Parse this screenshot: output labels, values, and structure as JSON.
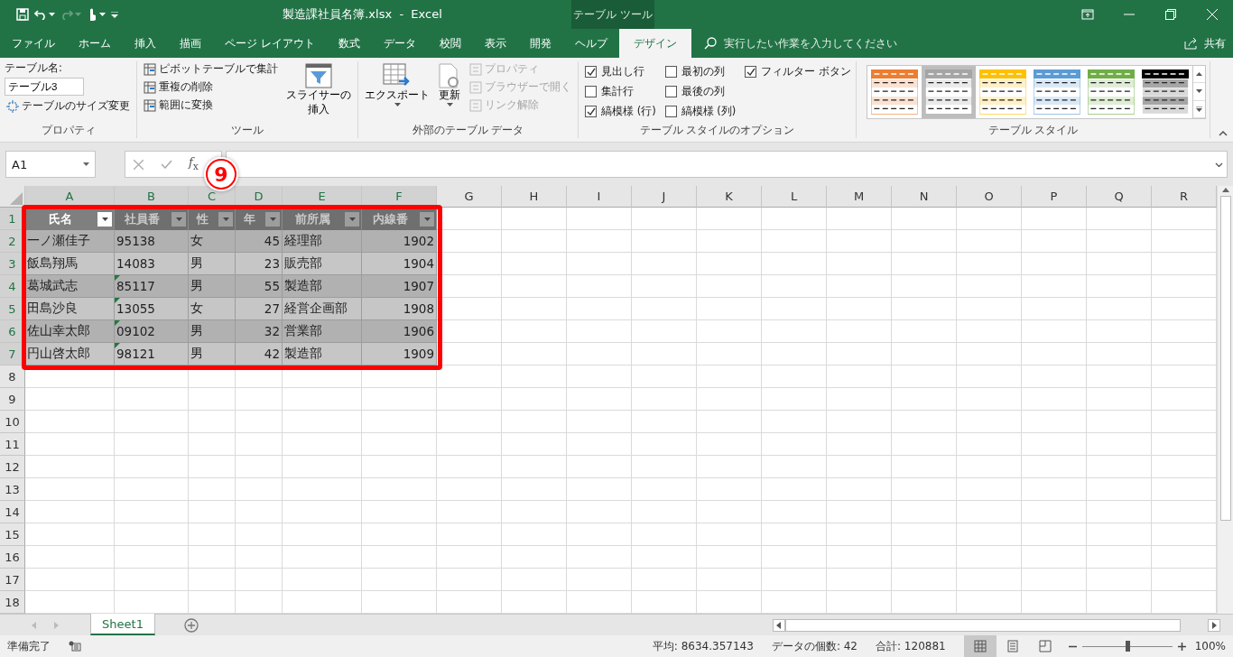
{
  "title_bar": {
    "title": "製造課社員名簿.xlsx  -  Excel",
    "context_tab": "テーブル ツール"
  },
  "ribbon_tabs": [
    {
      "label": "ファイル",
      "selected": false
    },
    {
      "label": "ホーム",
      "selected": false
    },
    {
      "label": "挿入",
      "selected": false
    },
    {
      "label": "描画",
      "selected": false
    },
    {
      "label": "ページ レイアウト",
      "selected": false
    },
    {
      "label": "数式",
      "selected": false
    },
    {
      "label": "データ",
      "selected": false
    },
    {
      "label": "校閲",
      "selected": false
    },
    {
      "label": "表示",
      "selected": false
    },
    {
      "label": "開発",
      "selected": false
    },
    {
      "label": "ヘルプ",
      "selected": false
    },
    {
      "label": "デザイン",
      "selected": true
    }
  ],
  "tell_me": {
    "placeholder": "実行したい作業を入力してください"
  },
  "share": "共有",
  "ribbon": {
    "properties": {
      "label": "テーブル名:",
      "table_name": "テーブル3",
      "resize": "テーブルのサイズ変更",
      "group": "プロパティ"
    },
    "tools": {
      "items": [
        "ピボットテーブルで集計",
        "重複の削除",
        "範囲に変換"
      ],
      "slicer": [
        "スライサーの",
        "挿入"
      ],
      "group": "ツール"
    },
    "external": {
      "export": "エクスポート",
      "refresh": "更新",
      "links": [
        {
          "label": "プロパティ",
          "disabled": true
        },
        {
          "label": "ブラウザーで開く",
          "disabled": true
        },
        {
          "label": "リンク解除",
          "disabled": true
        }
      ],
      "group": "外部のテーブル データ"
    },
    "style_options": {
      "options": [
        {
          "label": "見出し行",
          "checked": true
        },
        {
          "label": "集計行",
          "checked": false
        },
        {
          "label": "縞模様 (行)",
          "checked": true
        },
        {
          "label": "最初の列",
          "checked": false
        },
        {
          "label": "最後の列",
          "checked": false
        },
        {
          "label": "縞模様 (列)",
          "checked": false
        },
        {
          "label": "フィルター ボタン",
          "checked": true
        }
      ],
      "group": "テーブル スタイルのオプション"
    },
    "styles": {
      "items": [
        {
          "color": "#ed7d31",
          "selected": false
        },
        {
          "color": "#a5a5a5",
          "selected": true
        },
        {
          "color": "#ffc000",
          "selected": false
        },
        {
          "color": "#5b9bd5",
          "selected": false
        },
        {
          "color": "#70ad47",
          "selected": false
        },
        {
          "color": "#000000",
          "selected": false
        }
      ],
      "group": "テーブル スタイル"
    }
  },
  "formula_bar": {
    "name_box": "A1",
    "fx": "*f*$_{x}$"
  },
  "columns": [
    {
      "label": "A",
      "selected": true
    },
    {
      "label": "B",
      "selected": true
    },
    {
      "label": "C",
      "selected": true
    },
    {
      "label": "D",
      "selected": true
    },
    {
      "label": "E",
      "selected": true
    },
    {
      "label": "F",
      "selected": true
    },
    {
      "label": "G",
      "selected": false
    },
    {
      "label": "H",
      "selected": false
    },
    {
      "label": "I",
      "selected": false
    },
    {
      "label": "J",
      "selected": false
    },
    {
      "label": "K",
      "selected": false
    },
    {
      "label": "L",
      "selected": false
    },
    {
      "label": "M",
      "selected": false
    },
    {
      "label": "N",
      "selected": false
    },
    {
      "label": "O",
      "selected": false
    },
    {
      "label": "P",
      "selected": false
    },
    {
      "label": "Q",
      "selected": false
    },
    {
      "label": "R",
      "selected": false
    }
  ],
  "rows": [
    {
      "label": "1",
      "selected": true
    },
    {
      "label": "2",
      "selected": true
    },
    {
      "label": "3",
      "selected": true
    },
    {
      "label": "4",
      "selected": true
    },
    {
      "label": "5",
      "selected": true
    },
    {
      "label": "6",
      "selected": true
    },
    {
      "label": "7",
      "selected": true
    },
    {
      "label": "8",
      "selected": false
    },
    {
      "label": "9",
      "selected": false
    },
    {
      "label": "10",
      "selected": false
    },
    {
      "label": "11",
      "selected": false
    },
    {
      "label": "12",
      "selected": false
    },
    {
      "label": "13",
      "selected": false
    },
    {
      "label": "14",
      "selected": false
    },
    {
      "label": "15",
      "selected": false
    },
    {
      "label": "16",
      "selected": false
    },
    {
      "label": "17",
      "selected": false
    },
    {
      "label": "18",
      "selected": false
    }
  ],
  "table": {
    "headers": [
      {
        "label": "氏名",
        "active": true
      },
      {
        "label": "社員番",
        "active": false
      },
      {
        "label": "性",
        "active": false
      },
      {
        "label": "年",
        "active": false
      },
      {
        "label": "前所属",
        "active": false
      },
      {
        "label": "内線番",
        "active": false
      }
    ],
    "rows": [
      {
        "cells": [
          "一ノ瀬佳子",
          "95138",
          "女",
          "45",
          "経理部",
          "1902"
        ],
        "flag": false
      },
      {
        "cells": [
          "飯島翔馬",
          "14083",
          "男",
          "23",
          "販売部",
          "1904"
        ],
        "flag": false
      },
      {
        "cells": [
          "葛城武志",
          "85117",
          "男",
          "55",
          "製造部",
          "1907"
        ],
        "flag": true
      },
      {
        "cells": [
          "田島沙良",
          "13055",
          "女",
          "27",
          "経営企画部",
          "1908"
        ],
        "flag": true
      },
      {
        "cells": [
          "佐山幸太郎",
          "09102",
          "男",
          "32",
          "営業部",
          "1906"
        ],
        "flag": true
      },
      {
        "cells": [
          "円山啓太郎",
          "98121",
          "男",
          "42",
          "製造部",
          "1909"
        ],
        "flag": true
      }
    ]
  },
  "annotation": {
    "number": "9"
  },
  "sheet_tabs": [
    {
      "label": "Sheet1",
      "selected": true
    }
  ],
  "status_bar": {
    "ready": "準備完了",
    "average": "平均: 8634.357143",
    "count": "データの個数: 42",
    "sum": "合計: 120881",
    "views": [
      {
        "kind": "normal",
        "selected": true
      },
      {
        "kind": "page_layout",
        "selected": false
      },
      {
        "kind": "page_break",
        "selected": false
      }
    ],
    "zoom": {
      "level": 0.5,
      "reading": "100%"
    }
  }
}
